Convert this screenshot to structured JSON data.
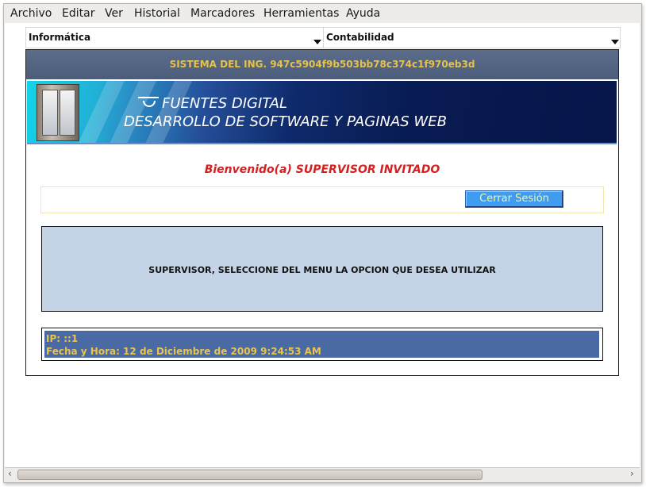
{
  "menubar": {
    "items": [
      "Archivo",
      "Editar",
      "Ver",
      "Historial",
      "Marcadores",
      "Herramientas",
      "Ayuda"
    ]
  },
  "topmenu": {
    "left": "Informática",
    "right": "Contabilidad"
  },
  "system_title": "SISTEMA DEL ING. 947c5904f9b503bb78c374c1f970eb3d",
  "banner": {
    "line1": "FUENTES DIGITAL",
    "line2": "DESARROLLO DE SOFTWARE Y PAGINAS WEB"
  },
  "welcome": "Bienvenido(a) SUPERVISOR INVITADO",
  "logout_label": "Cerrar Sesión",
  "info_message": "SUPERVISOR, SELECCIONE DEL MENU LA OPCION QUE DESEA UTILIZAR",
  "footer": {
    "ip": "IP: ::1",
    "datetime": "Fecha y Hora: 12 de Diciembre de 2009 9:24:53 AM"
  },
  "colors": {
    "system_text": "#e6c24a",
    "welcome_text": "#d42020",
    "info_bg": "#c4d3e5",
    "footer_bg": "#4a6aa6",
    "button_bg": "#3f9cf0"
  }
}
